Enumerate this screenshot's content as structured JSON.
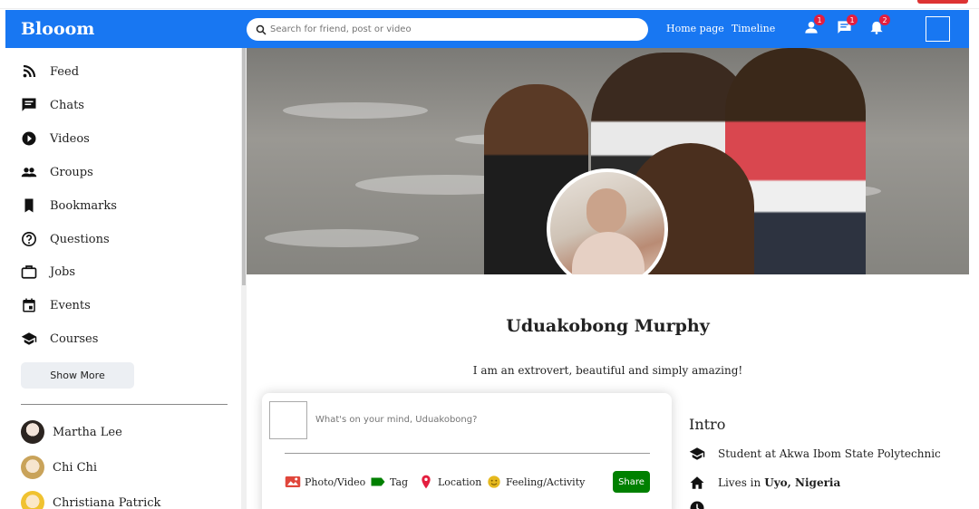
{
  "app": {
    "logo": "Blooom"
  },
  "search": {
    "placeholder": "Search for friend, post or video"
  },
  "top_links": [
    "Home page",
    "Timeline"
  ],
  "top_icons": [
    {
      "icon": "person-icon",
      "badge": "1"
    },
    {
      "icon": "chat-icon",
      "badge": "1"
    },
    {
      "icon": "bell-icon",
      "badge": "2"
    }
  ],
  "sidebar": {
    "items": [
      {
        "label": "Feed",
        "icon": "rss-icon"
      },
      {
        "label": "Chats",
        "icon": "chat-icon"
      },
      {
        "label": "Videos",
        "icon": "play-circle-icon"
      },
      {
        "label": "Groups",
        "icon": "group-icon"
      },
      {
        "label": "Bookmarks",
        "icon": "bookmark-icon"
      },
      {
        "label": "Questions",
        "icon": "help-circle-icon"
      },
      {
        "label": "Jobs",
        "icon": "briefcase-icon"
      },
      {
        "label": "Events",
        "icon": "calendar-icon"
      },
      {
        "label": "Courses",
        "icon": "school-icon"
      }
    ],
    "show_more": "Show More",
    "friends": [
      "Martha Lee",
      "Chi Chi",
      "Christiana Patrick"
    ]
  },
  "profile": {
    "name": "Uduakobong Murphy",
    "bio": "I am an extrovert, beautiful and simply amazing!"
  },
  "post": {
    "placeholder": "What's on your mind, Uduakobong?",
    "options": [
      "Photo/Video",
      "Tag",
      "Location",
      "Feeling/Activity"
    ],
    "share": "Share"
  },
  "intro": {
    "title": "Intro",
    "study": "Student at Akwa Ibom State Polytechnic",
    "lives_prefix": "Lives in",
    "lives_place": "Uyo, Nigeria"
  },
  "colors": {
    "brand": "#1877f2",
    "share": "#008000",
    "badge": "#e41e3f"
  }
}
